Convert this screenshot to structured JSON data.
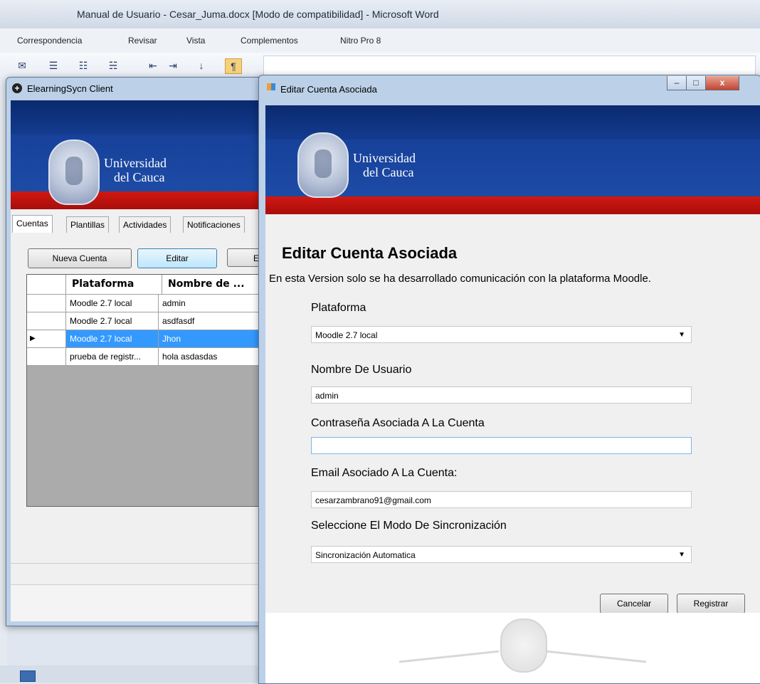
{
  "word": {
    "title": "Manual de Usuario - Cesar_Juma.docx [Modo de compatibilidad] - Microsoft Word",
    "tabs": [
      "Correspondencia",
      "Revisar",
      "Vista",
      "Complementos",
      "Nitro Pro 8"
    ]
  },
  "banner": {
    "line1": "Universidad",
    "line2": "del Cauca"
  },
  "client_window": {
    "title": "ElearningSycn Client",
    "tabs": [
      "Cuentas",
      "Plantillas",
      "Actividades",
      "Notificaciones"
    ],
    "buttons": {
      "new_account": "Nueva Cuenta",
      "edit": "Editar",
      "partial": "E"
    },
    "grid": {
      "columns": [
        "Plataforma",
        "Nombre de ..."
      ],
      "rows": [
        {
          "plataforma": "Moodle 2.7 local",
          "nombre": "admin"
        },
        {
          "plataforma": "Moodle 2.7 local",
          "nombre": "asdfasdf"
        },
        {
          "plataforma": "Moodle 2.7 local",
          "nombre": "Jhon"
        },
        {
          "plataforma": "prueba de registr...",
          "nombre": "hola asdasdas"
        }
      ],
      "selected_row": 2,
      "row_indicator": "▶"
    }
  },
  "dialog": {
    "title": "Editar Cuenta Asociada",
    "heading": "Editar Cuenta Asociada",
    "subtitle": "En esta Version solo se ha desarrollado comunicación con la plataforma Moodle.",
    "fields": {
      "plataforma_label": "Plataforma",
      "plataforma_value": "Moodle 2.7 local",
      "usuario_label": "Nombre De Usuario",
      "usuario_value": "admin",
      "password_label": "Contraseña Asociada A La Cuenta",
      "password_value": "",
      "email_label": "Email Asociado A La Cuenta:",
      "email_value": "cesarzambrano91@gmail.com",
      "sync_label": "Seleccione El Modo De Sincronización",
      "sync_value": "Sincronización Automatica"
    },
    "buttons": {
      "cancel": "Cancelar",
      "register": "Registrar"
    },
    "window_controls": {
      "minimize": "–",
      "maximize": "□",
      "close": "x"
    }
  },
  "colors": {
    "banner_blue": "#17419a",
    "banner_red": "#d01812",
    "selection_blue": "#3399ff"
  }
}
